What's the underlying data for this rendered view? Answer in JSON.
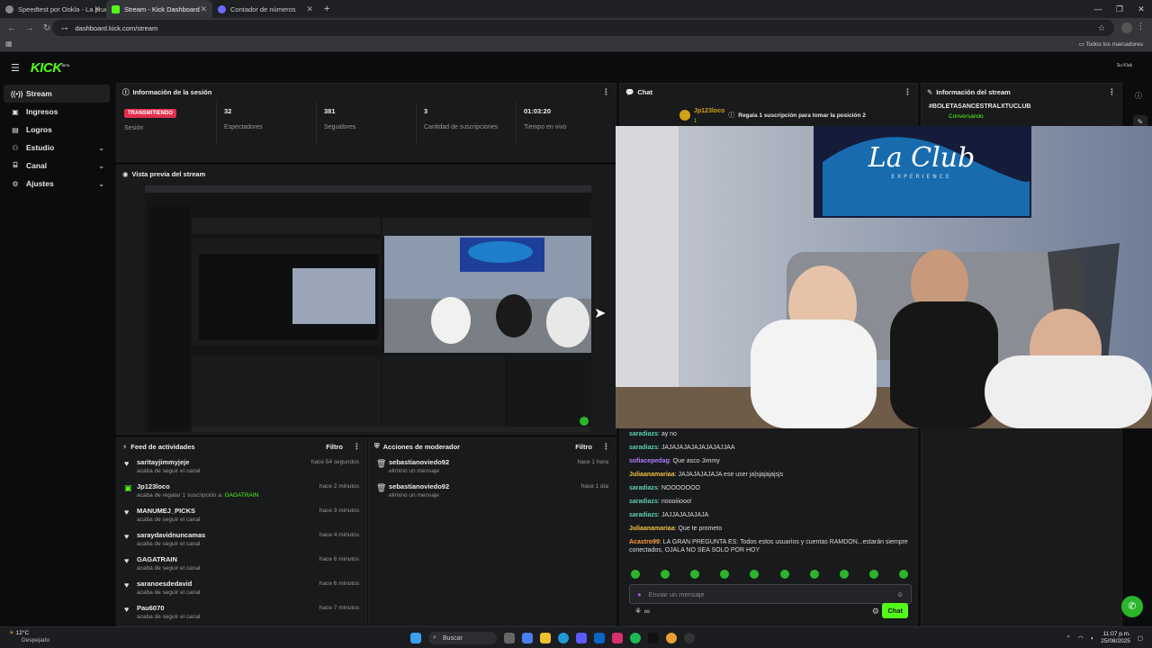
{
  "browser": {
    "tabs": [
      {
        "title": "Speedtest por Ookla - La prueb",
        "color": "#888888"
      },
      {
        "title": "Stream - Kick Dashboard",
        "color": "#53fc18"
      },
      {
        "title": "Contador de números",
        "color": "#6b6bff"
      }
    ],
    "url": "dashboard.kick.com/stream",
    "bookmarks_label": "Todos los marcadores"
  },
  "app": {
    "logo": "KICK",
    "logo_tag": "BETA",
    "user_badge": "Su Kluk"
  },
  "sidebar": {
    "items": [
      {
        "label": "Stream",
        "icon": "stream-icon"
      },
      {
        "label": "Ingresos",
        "icon": "money-icon"
      },
      {
        "label": "Logros",
        "icon": "trophy-icon"
      },
      {
        "label": "Estudio",
        "icon": "studio-icon"
      },
      {
        "label": "Canal",
        "icon": "channel-icon"
      },
      {
        "label": "Ajustes",
        "icon": "gear-icon"
      }
    ]
  },
  "session": {
    "title": "Información de la sesión",
    "status": "TRANSMITIENDO",
    "status_label": "Sesión",
    "stats": [
      {
        "value": "32",
        "label": "Espectadores"
      },
      {
        "value": "381",
        "label": "Seguidores"
      },
      {
        "value": "3",
        "label": "Cantidad de suscripciones"
      },
      {
        "value": "01:03:20",
        "label": "Tiempo en vivo"
      }
    ]
  },
  "preview": {
    "title": "Vista previa del stream"
  },
  "feed": {
    "title": "Feed de actividades",
    "filter": "Filtro",
    "items": [
      {
        "name": "saritayjimmyjeje",
        "sub": "acaba de seguir el canal",
        "time": "hace 54 segundos",
        "icon": "heart-icon"
      },
      {
        "name": "Jp123loco",
        "sub": "acaba de regalar 1 suscripción a: GAGATRAIN",
        "time": "hace 2 minutos",
        "icon": "gift-icon"
      },
      {
        "name": "MANUMEJ_PICKS",
        "sub": "acaba de seguir el canal",
        "time": "hace 3 minutos",
        "icon": "heart-icon"
      },
      {
        "name": "saraydavidnuncamas",
        "sub": "acaba de seguir el canal",
        "time": "hace 4 minutos",
        "icon": "heart-icon"
      },
      {
        "name": "GAGATRAIN",
        "sub": "acaba de seguir el canal",
        "time": "hace 6 minutos",
        "icon": "heart-icon"
      },
      {
        "name": "saranoesdedavid",
        "sub": "acaba de seguir el canal",
        "time": "hace 6 minutos",
        "icon": "heart-icon"
      },
      {
        "name": "Pau6070",
        "sub": "acaba de seguir el canal",
        "time": "hace 7 minutos",
        "icon": "heart-icon"
      }
    ]
  },
  "mod": {
    "title": "Acciones de moderador",
    "filter": "Filtro",
    "items": [
      {
        "name": "sebastianoviedo92",
        "sub": "eliminó un mensaje",
        "time": "hace 1 hora"
      },
      {
        "name": "sebastianoviedo92",
        "sub": "eliminó un mensaje",
        "time": "hace 1 día"
      }
    ]
  },
  "chat": {
    "title": "Chat",
    "pinned_user": "Jp123loco",
    "pinned_count": "1",
    "pinned_text": "Regala 1 suscripción para tomar la posición 2",
    "messages": [
      {
        "user": "saradiazs",
        "text": "ay no",
        "color": "#5fd0b0"
      },
      {
        "user": "saradiazs",
        "text": "JAJAJAJAJAJAJAJAJJAA",
        "color": "#5fd0b0"
      },
      {
        "user": "sofiacepedag",
        "text": "Que asco Jimmy",
        "color": "#b07cff"
      },
      {
        "user": "Juliaanamariaa",
        "text": "JAJAJAJAJAJA ese user ja|sjajajajsjs",
        "color": "#f0c040"
      },
      {
        "user": "saradiazs",
        "text": "NOOOOOOO",
        "color": "#5fd0b0"
      },
      {
        "user": "saradiazs",
        "text": "noooiiiooo!",
        "color": "#5fd0b0"
      },
      {
        "user": "saradiazs",
        "text": "JAJJAJAJAJAJA",
        "color": "#5fd0b0"
      },
      {
        "user": "Juliaanamariaa",
        "text": "Que te prometo",
        "color": "#f0c040"
      },
      {
        "user": "Acastro99",
        "text": "LA GRAN PREGUNTA ES: Todos estos usuarios y cuentas RAMDON...estarán siempre conectados, OJALA NO SEA SOLO POR HOY",
        "color": "#ff9a3c"
      }
    ],
    "placeholder": "Enviar un mensaje",
    "send_label": "Chat",
    "points": "∞"
  },
  "stream_info": {
    "title": "Información del stream",
    "tag": "#BOLETASANCESTRALXTUCLUB",
    "category": "Conversando"
  },
  "video": {
    "sign_text": "La Club",
    "sign_sub": "EXPERIENCE"
  },
  "taskbar": {
    "weather_temp": "12°C",
    "weather_desc": "Despejado",
    "search": "Buscar",
    "time": "11:07 p.m.",
    "date": "25/08/2025"
  }
}
